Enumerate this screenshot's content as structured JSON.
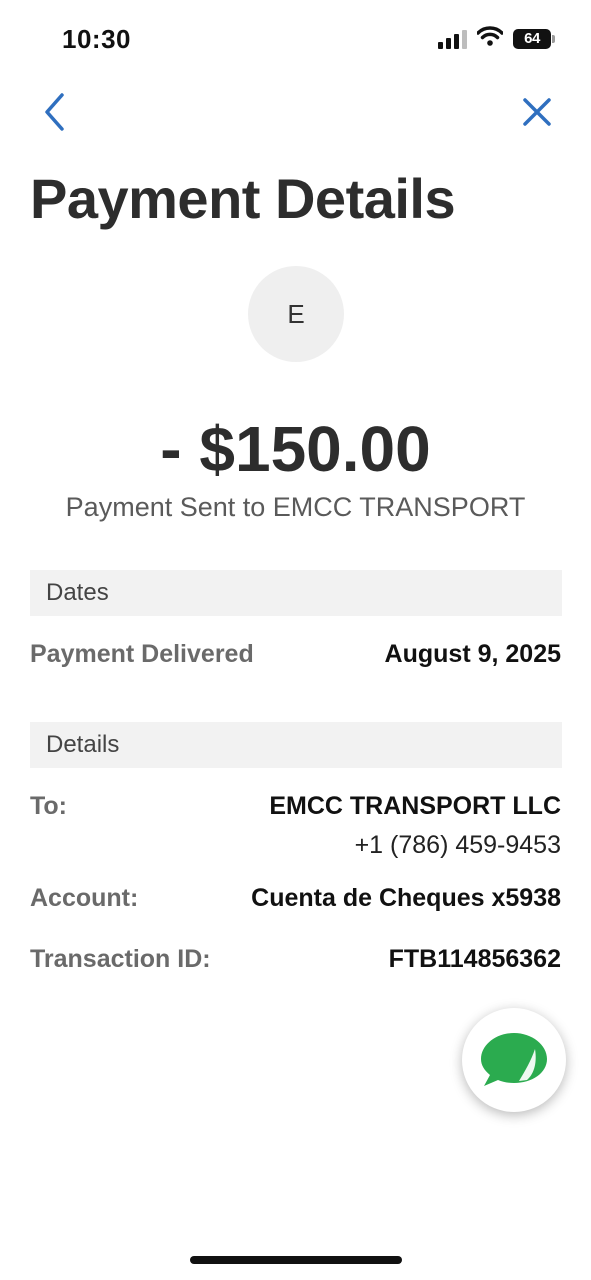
{
  "status_bar": {
    "time": "10:30",
    "battery_level": "64"
  },
  "nav": {
    "back_icon": "chevron-left-icon",
    "close_icon": "close-icon",
    "accent_color": "#2f6fbf"
  },
  "page_title": "Payment Details",
  "recipient": {
    "avatar_initial": "E"
  },
  "payment": {
    "amount": "- $150.00",
    "description": "Payment Sent to EMCC TRANSPORT"
  },
  "dates_section": {
    "header": "Dates",
    "payment_delivered_label": "Payment Delivered",
    "payment_delivered_value": "August 9, 2025"
  },
  "details_section": {
    "header": "Details",
    "to_label": "To:",
    "to_name": "EMCC TRANSPORT LLC",
    "to_phone": "+1 (786) 459-9453",
    "account_label": "Account:",
    "account_value": "Cuenta de Cheques x5938",
    "transaction_label": "Transaction ID:",
    "transaction_value": "FTB114856362"
  },
  "chat_button": {
    "icon": "chat-bubble-icon",
    "color": "#2bab4f"
  }
}
